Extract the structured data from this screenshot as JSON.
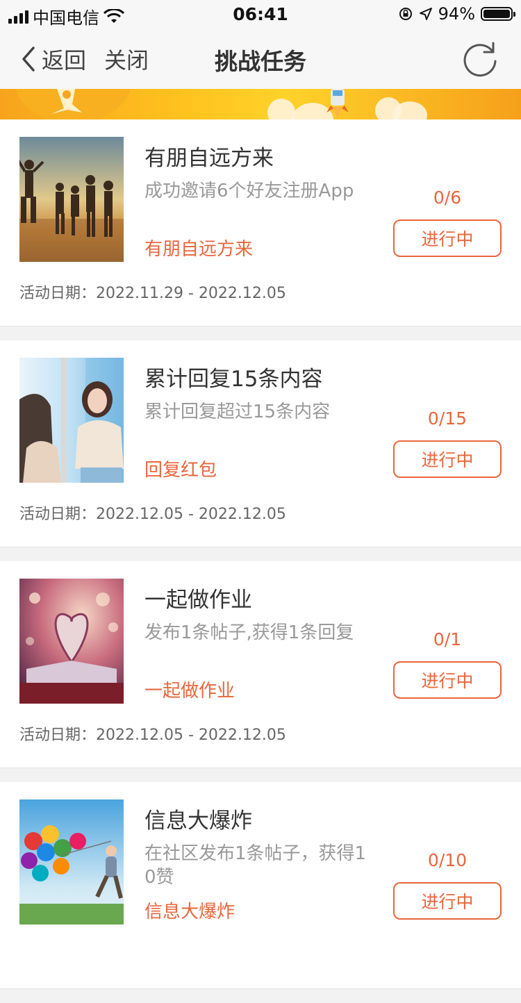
{
  "status_bar": {
    "carrier": "中国电信",
    "time": "06:41",
    "battery_percent": "94%"
  },
  "nav": {
    "back_label": "返回",
    "close_label": "关闭",
    "title": "挑战任务"
  },
  "colors": {
    "accent": "#e8663b",
    "banner": "#ffc21e"
  },
  "tasks": [
    {
      "title": "有朋自远方来",
      "description": "成功邀请6个好友注册App",
      "tag": "有朋自远方来",
      "progress": "0/6",
      "status": "进行中",
      "date_label": "活动日期：",
      "date_range": "2022.11.29 - 2022.12.05",
      "image": "beach-friends-photo"
    },
    {
      "title": "累计回复15条内容",
      "description": "累计回复超过15条内容",
      "tag": "回复红包",
      "progress": "0/15",
      "status": "进行中",
      "date_label": "活动日期：",
      "date_range": "2022.12.05 - 2022.12.05",
      "image": "two-girls-window-photo"
    },
    {
      "title": "一起做作业",
      "description": "发布1条帖子,获得1条回复",
      "tag": "一起做作业",
      "progress": "0/1",
      "status": "进行中",
      "date_label": "活动日期：",
      "date_range": "2022.12.05 - 2022.12.05",
      "image": "book-heart-photo"
    },
    {
      "title": "信息大爆炸",
      "description": "在社区发布1条帖子，获得1\n0赞",
      "tag": "信息大爆炸",
      "progress": "0/10",
      "status": "进行中",
      "date_label": "",
      "date_range": "",
      "image": "balloons-child-photo"
    }
  ]
}
